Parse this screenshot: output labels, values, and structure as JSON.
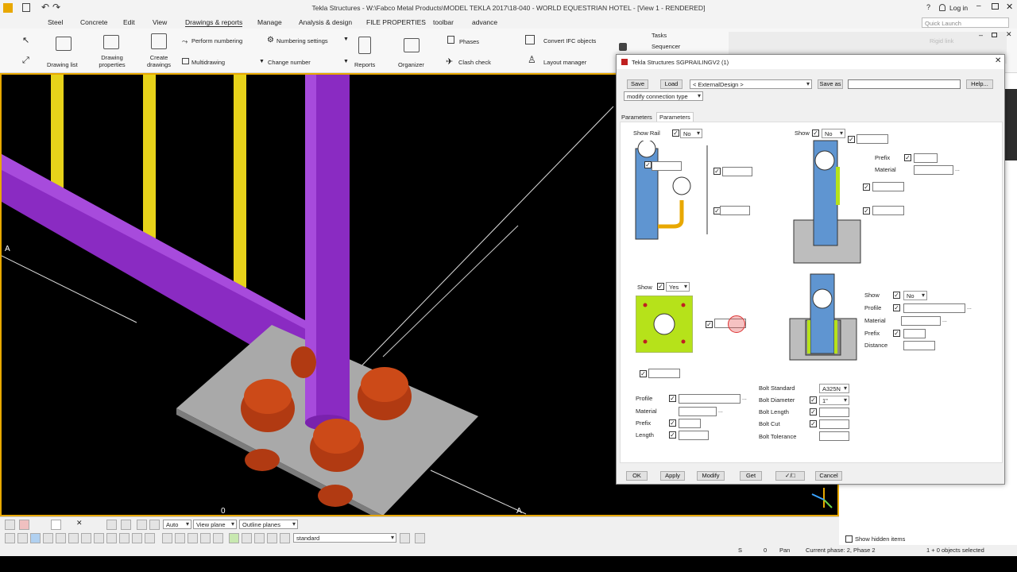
{
  "window": {
    "title": "Tekla Structures - W:\\Fabco Metal Products\\MODEL TEKLA 2017\\18-040 - WORLD EQUESTRIAN HOTEL  - [View 1 - RENDERED]",
    "help": "?",
    "login": "Log in",
    "quick_launch_placeholder": "Quick Launch"
  },
  "menu": [
    "Steel",
    "Concrete",
    "Edit",
    "View",
    "Drawings & reports",
    "Manage",
    "Analysis & design",
    "FILE PROPERTIES",
    "toolbar",
    "advance"
  ],
  "ribbon": {
    "drawing_list": "Drawing list",
    "drawing_properties": "Drawing properties",
    "create_drawings": "Create drawings",
    "perform_numbering": "Perform numbering",
    "numbering_settings": "Numbering settings",
    "multidrawing": "Multidrawing",
    "change_number": "Change number",
    "reports": "Reports",
    "organizer": "Organizer",
    "phases": "Phases",
    "clash_check": "Clash check",
    "convert_ifc": "Convert IFC objects",
    "layout_manager": "Layout manager",
    "tasks": "Tasks",
    "sequencer": "Sequencer",
    "rigid_link": "Rigid link"
  },
  "viewport": {
    "grid_label_a_left": "A",
    "grid_label_a_right": "A",
    "grid_label_0": "0"
  },
  "dialog": {
    "title": "Tekla Structures  SGPRAILINGV2 (1)",
    "save": "Save",
    "load": "Load",
    "load_value": "< ExternalDesign >",
    "save_as": "Save as",
    "help": "Help...",
    "modify_type": "modify connection type",
    "tabs": [
      "Parameters",
      "Parameters"
    ],
    "show_rail_label": "Show Rail",
    "show_rail_value": "No",
    "show_top_right_label": "Show",
    "show_top_right_value": "No",
    "prefix_label": "Prefix",
    "material_label": "Material",
    "show_mid_left_label": "Show",
    "show_mid_left_value": "Yes",
    "show_mid_right_label": "Show",
    "show_mid_right_value": "No",
    "profile_label": "Profile",
    "distance_label": "Distance",
    "length_label": "Length",
    "bolt_standard_label": "Bolt Standard",
    "bolt_standard_value": "A325N",
    "bolt_diameter_label": "Bolt Diameter",
    "bolt_diameter_value": "1\"",
    "bolt_length_label": "Bolt Length",
    "bolt_cut_label": "Bolt Cut",
    "bolt_tolerance_label": "Bolt Tolerance",
    "ok": "OK",
    "apply": "Apply",
    "modify": "Modify",
    "get": "Get",
    "cancel": "Cancel"
  },
  "bottom": {
    "auto": "Auto",
    "view_plane": "View plane",
    "outline_planes": "Outline planes",
    "standard": "standard",
    "show_hidden": "Show hidden items"
  },
  "status": {
    "s": "S",
    "zero": "0",
    "pan": "Pan",
    "phase": "Current phase: 2, Phase 2",
    "selected": "1 + 0 objects selected"
  },
  "colors": {
    "purple_pipe": "#8a2bc2",
    "yellow_post": "#e7d21a",
    "bolt_orange": "#b13a12",
    "plate_gray": "#a9a9a9",
    "accent_orange": "#e8a800",
    "diagram_blue": "#5f95d1",
    "diagram_green": "#b6e21a"
  }
}
